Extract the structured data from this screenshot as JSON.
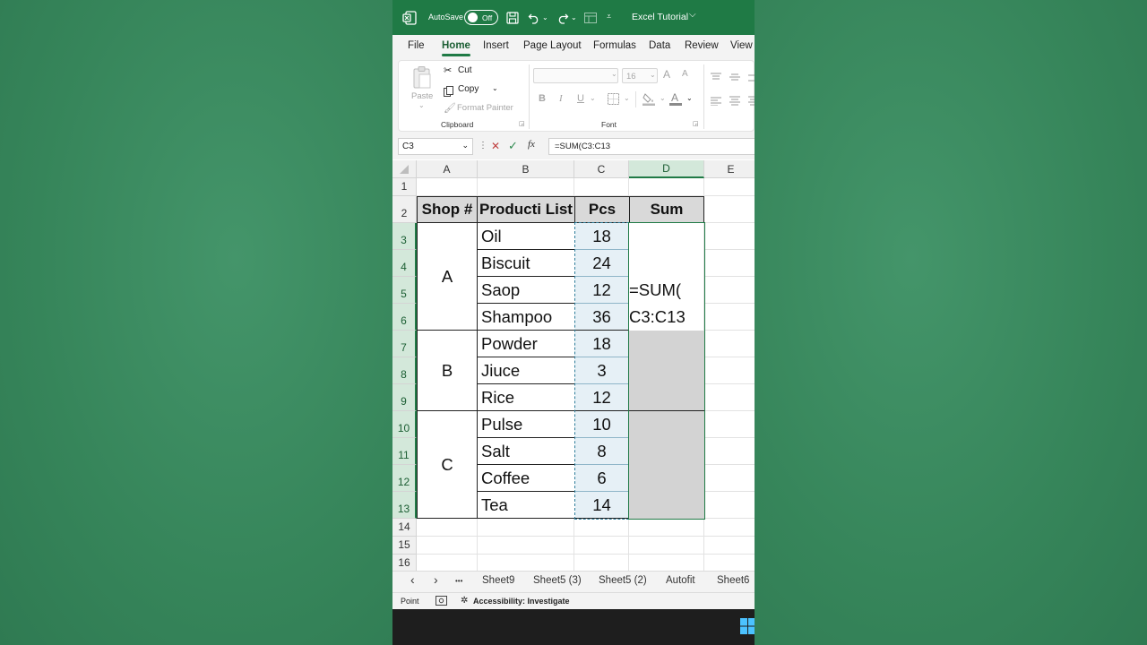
{
  "titlebar": {
    "autosave_label": "AutoSave",
    "autosave_state": "Off",
    "file_title": "Excel Tutorial",
    "chevron": "⌵"
  },
  "tabs": [
    "File",
    "Home",
    "Insert",
    "Page Layout",
    "Formulas",
    "Data",
    "Review",
    "View"
  ],
  "active_tab": "Home",
  "ribbon": {
    "paste": "Paste",
    "cut": "Cut",
    "copy": "Copy",
    "format_painter": "Format Painter",
    "clipboard_group": "Clipboard",
    "font_group": "Font",
    "font_size": "16",
    "bold": "B",
    "italic": "I",
    "underline": "U",
    "grow_font": "A",
    "shrink_font": "A",
    "font_color_glyph": "A"
  },
  "formula_bar": {
    "name_box": "C3",
    "cancel": "✕",
    "enter": "✓",
    "fx": "fx",
    "formula": "=SUM(C3:C13"
  },
  "columns": [
    "A",
    "B",
    "C",
    "D",
    "E"
  ],
  "rows": [
    "1",
    "2",
    "3",
    "4",
    "5",
    "6",
    "7",
    "8",
    "9",
    "10",
    "11",
    "12",
    "13",
    "14",
    "15",
    "16"
  ],
  "table": {
    "headers": [
      "Shop #",
      "Producti List",
      "Pcs",
      "Sum"
    ],
    "groups": [
      "A",
      "B",
      "C"
    ],
    "products": [
      "Oil",
      "Biscuit",
      "Saop",
      "Shampoo",
      "Powder",
      "Jiuce",
      "Rice",
      "Pulse",
      "Salt",
      "Coffee",
      "Tea"
    ],
    "pcs": [
      "18",
      "24",
      "12",
      "36",
      "18",
      "3",
      "12",
      "10",
      "8",
      "6",
      "14"
    ],
    "sum_edit_line1": "=SUM(",
    "sum_edit_line2": "C3:C13"
  },
  "sheet_tabs": [
    "Sheet9",
    "Sheet5 (3)",
    "Sheet5 (2)",
    "Autofit",
    "Sheet6"
  ],
  "sheet_nav": {
    "prev": "‹",
    "next": "›",
    "more": "•••"
  },
  "status": {
    "mode": "Point",
    "accessibility": "Accessibility: Investigate"
  },
  "colors": {
    "excel_green": "#1f7a45",
    "header_fill": "#d9d9d9",
    "copy_marquee": "#2e7d9a",
    "selected_fill": "#e6f0f6"
  }
}
